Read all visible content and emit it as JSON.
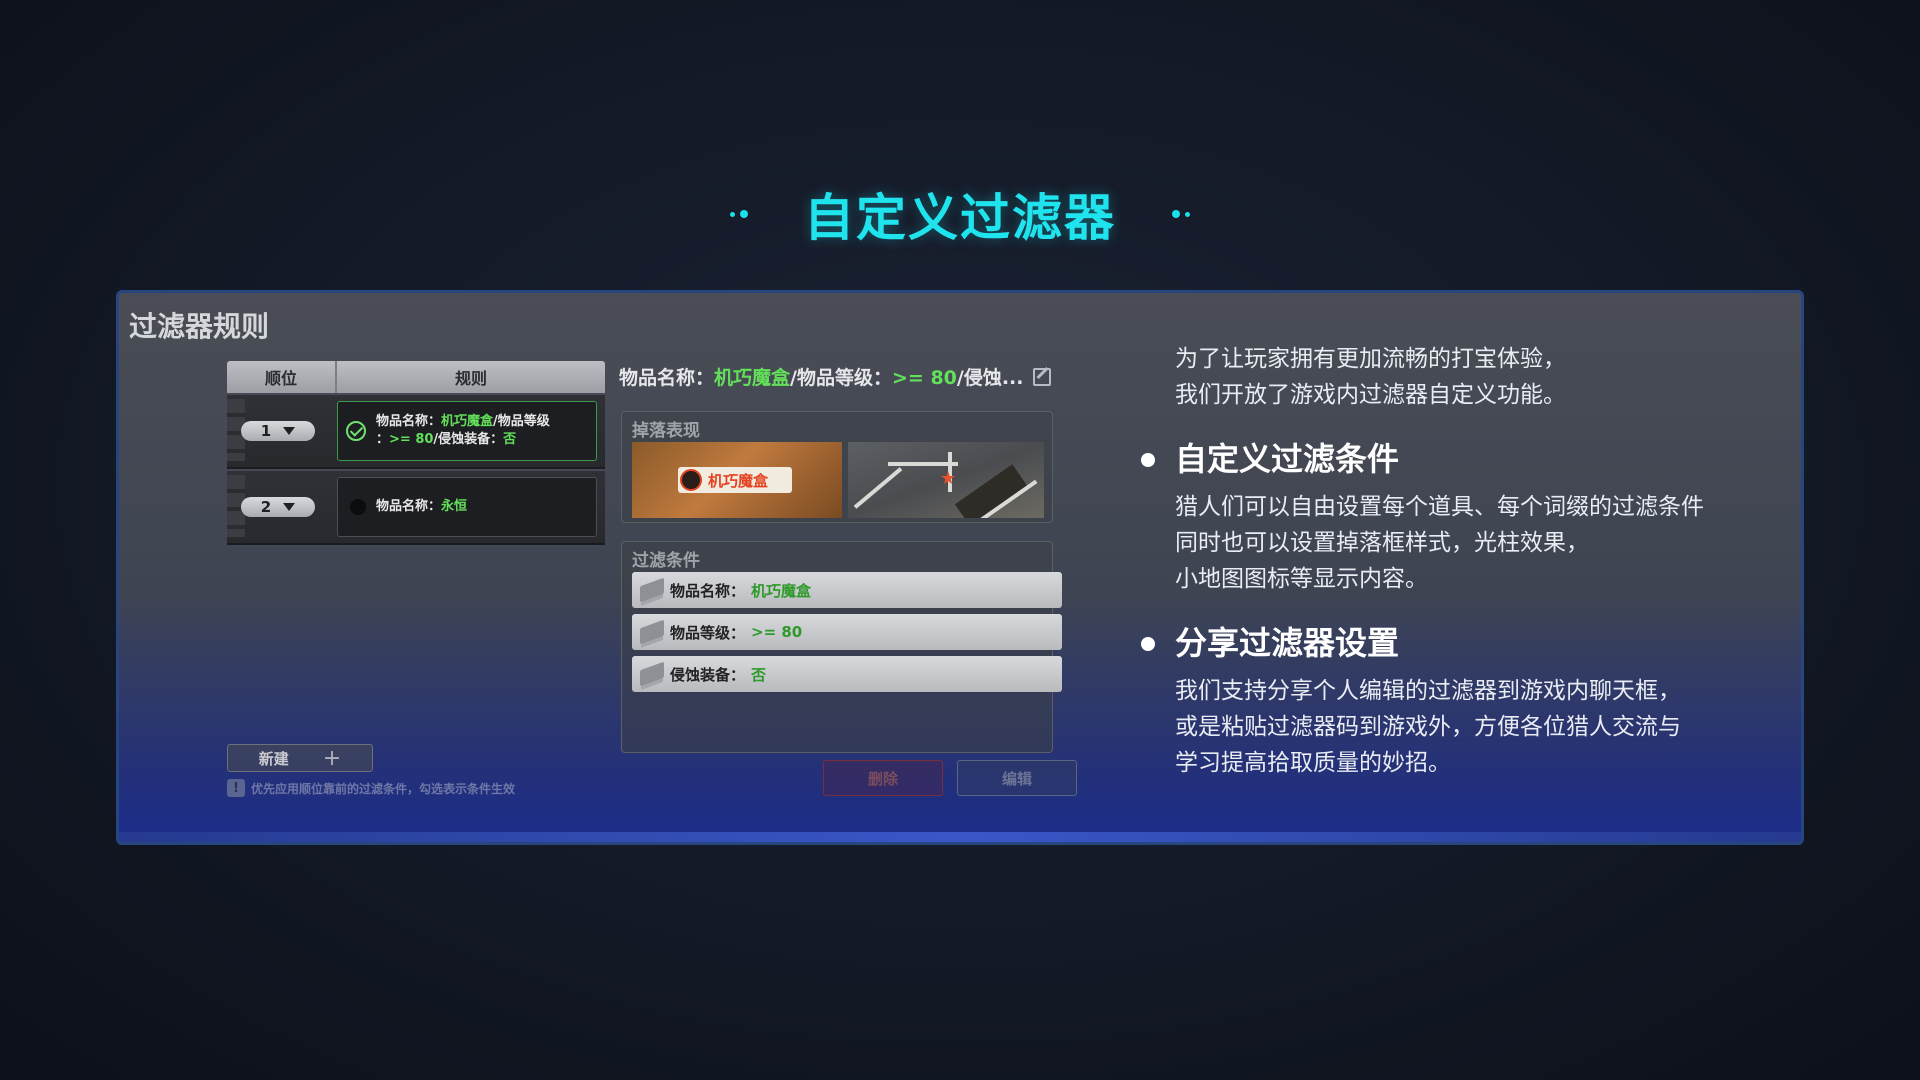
{
  "header": {
    "title": "自定义过滤器",
    "accent_color": "#1fe4ee"
  },
  "game_ui": {
    "panel_title": "过滤器规则",
    "table_headers": {
      "order": "顺位",
      "rule": "规则"
    },
    "rules": [
      {
        "order": "1",
        "active": true,
        "line1_label": "物品名称：",
        "line1_value": "机巧魔盒",
        "line1_suffix": "/物品等级",
        "line2_prefix": "：",
        "line2_value": ">= 80",
        "line2_label": "/侵蚀装备：",
        "line2_value2": "否"
      },
      {
        "order": "2",
        "active": false,
        "line1_label": "物品名称：",
        "line1_value": "永恒"
      }
    ],
    "detail_header": {
      "label1": "物品名称：",
      "value1": "机巧魔盒",
      "label2": "/物品等级：",
      "value2": ">= 80",
      "rest": "/侵蚀..."
    },
    "drop_section_title": "掉落表现",
    "drop_tag_text": "机巧魔盒",
    "filter_section_title": "过滤条件",
    "conditions": [
      {
        "label": "物品名称：",
        "value": "机巧魔盒"
      },
      {
        "label": "物品等级：",
        "value": ">= 80"
      },
      {
        "label": "侵蚀装备：",
        "value": "否"
      }
    ],
    "new_button": "新建",
    "hint_text": "优先应用顺位靠前的过滤条件，勾选表示条件生效",
    "delete_button": "删除",
    "edit_button": "编辑"
  },
  "description": {
    "intro_lines": [
      "为了让玩家拥有更加流畅的打宝体验，",
      "我们开放了游戏内过滤器自定义功能。"
    ],
    "sections": [
      {
        "title": "自定义过滤条件",
        "lines": [
          "猎人们可以自由设置每个道具、每个词缀的过滤条件",
          "同时也可以设置掉落框样式，光柱效果，",
          "小地图图标等显示内容。"
        ]
      },
      {
        "title": "分享过滤器设置",
        "lines": [
          "我们支持分享个人编辑的过滤器到游戏内聊天框，",
          "或是粘贴过滤器码到游戏外，方便各位猎人交流与",
          "学习提高拾取质量的妙招。"
        ]
      }
    ]
  }
}
